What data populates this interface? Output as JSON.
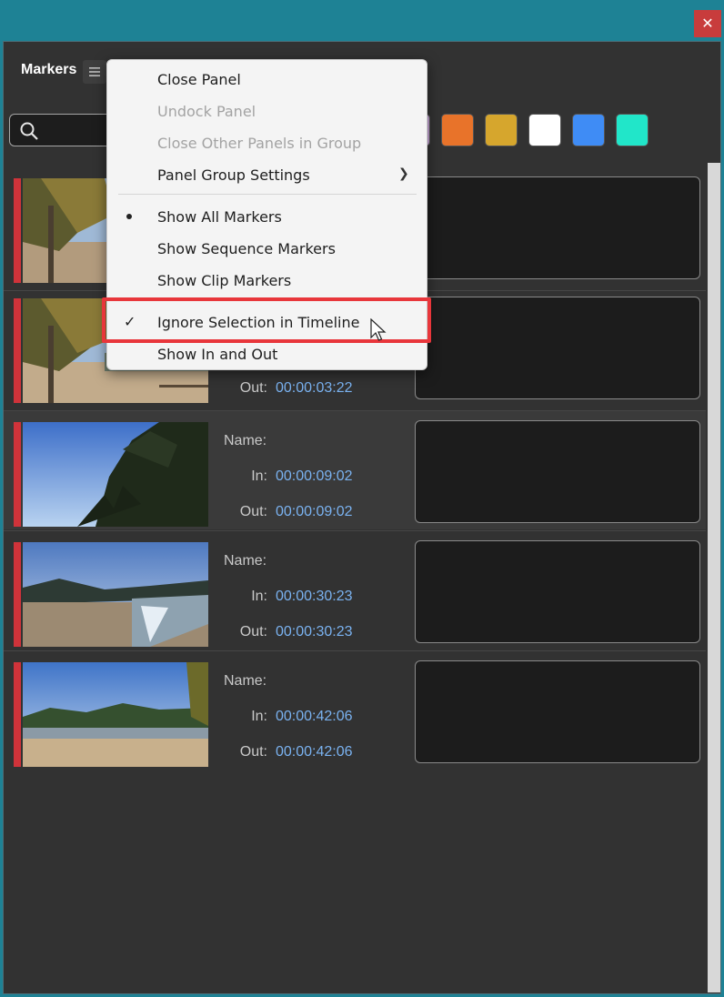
{
  "panel": {
    "title": "Markers"
  },
  "colors": {
    "marker_red": "#d0333a",
    "timecode_blue": "#7ab2f0",
    "swatch_orange": "#e8732a",
    "swatch_yellow": "#d6a62d",
    "swatch_white": "#ffffff",
    "swatch_blue": "#3f8cf5",
    "swatch_cyan": "#21e6c9",
    "highlight_red": "#e8363b"
  },
  "menu": {
    "items": [
      {
        "label": "Close Panel",
        "enabled": true
      },
      {
        "label": "Undock Panel",
        "enabled": false
      },
      {
        "label": "Close Other Panels in Group",
        "enabled": false
      },
      {
        "label": "Panel Group Settings",
        "enabled": true,
        "submenu": true
      },
      {
        "label": "Show All Markers",
        "enabled": true,
        "selected": true
      },
      {
        "label": "Show Sequence Markers",
        "enabled": true
      },
      {
        "label": "Show Clip Markers",
        "enabled": true
      },
      {
        "label": "Ignore Selection in Timeline",
        "enabled": true,
        "checked": true
      },
      {
        "label": "Show In and Out",
        "enabled": true
      }
    ]
  },
  "labels": {
    "name": "Name:",
    "in": "In:",
    "out": "Out:"
  },
  "markers": [
    {
      "in": "",
      "out": ""
    },
    {
      "in": "",
      "out": "00:00:03:22"
    },
    {
      "in": "00:00:09:02",
      "out": "00:00:09:02"
    },
    {
      "in": "00:00:30:23",
      "out": "00:00:30:23"
    },
    {
      "in": "00:00:42:06",
      "out": "00:00:42:06"
    }
  ]
}
